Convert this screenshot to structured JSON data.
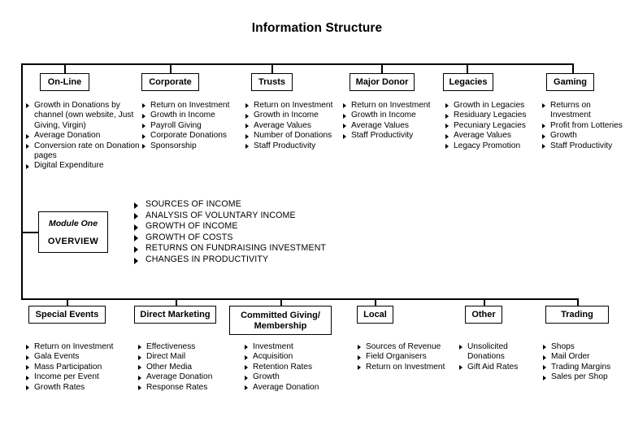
{
  "diagram": {
    "title": "Information Structure",
    "type": "organizational-tree",
    "colors": {
      "line": "#000000",
      "background": "#ffffff",
      "text": "#000000"
    },
    "bullet_icon": "triangle-right-bullet"
  },
  "top_branches": [
    {
      "label": "On-Line",
      "items": [
        "Growth in Donations by channel (own website, Just Giving, Virgin)",
        "Average Donation",
        "Conversion rate on Donation pages",
        "Digital Expenditure"
      ]
    },
    {
      "label": "Corporate",
      "items": [
        "Return on Investment",
        "Growth in Income",
        "Payroll Giving",
        "Corporate Donations",
        "Sponsorship"
      ]
    },
    {
      "label": "Trusts",
      "items": [
        "Return on Investment",
        "Growth in Income",
        "Average Values",
        "Number of Donations",
        "Staff Productivity"
      ]
    },
    {
      "label": "Major Donor",
      "items": [
        "Return on Investment",
        "Growth in Income",
        "Average Values",
        "Staff Productivity"
      ]
    },
    {
      "label": "Legacies",
      "items": [
        "Growth in Legacies",
        "Residuary Legacies",
        "Pecuniary Legacies",
        "Average Values",
        "Legacy Promotion"
      ]
    },
    {
      "label": "Gaming",
      "items": [
        "Returns on Investment",
        "Profit from Lotteries",
        "Growth",
        "Staff Productivity"
      ]
    }
  ],
  "module": {
    "name": "Module One",
    "subtitle": "OVERVIEW",
    "items": [
      "SOURCES OF INCOME",
      "ANALYSIS OF VOLUNTARY INCOME",
      "GROWTH OF INCOME",
      "GROWTH OF COSTS",
      "RETURNS ON FUNDRAISING INVESTMENT",
      "CHANGES IN PRODUCTIVITY"
    ]
  },
  "bottom_branches": [
    {
      "label": "Special Events",
      "items": [
        "Return on Investment",
        "Gala Events",
        "Mass Participation",
        "Income per Event",
        "Growth Rates"
      ]
    },
    {
      "label": "Direct Marketing",
      "items": [
        "Effectiveness",
        "Direct Mail",
        "Other Media",
        "Average Donation",
        "Response Rates"
      ]
    },
    {
      "label": "Committed Giving/ Membership",
      "label_line1": "Committed Giving/",
      "label_line2": "Membership",
      "items": [
        "Investment",
        "Acquisition",
        "Retention Rates",
        "Growth",
        "Average Donation"
      ]
    },
    {
      "label": "Local",
      "items": [
        "Sources of Revenue",
        "Field Organisers",
        "Return on Investment"
      ]
    },
    {
      "label": "Other",
      "items": [
        "Unsolicited Donations",
        "Gift Aid Rates"
      ]
    },
    {
      "label": "Trading",
      "items": [
        "Shops",
        "Mail Order",
        "Trading Margins",
        "Sales per Shop"
      ]
    }
  ]
}
